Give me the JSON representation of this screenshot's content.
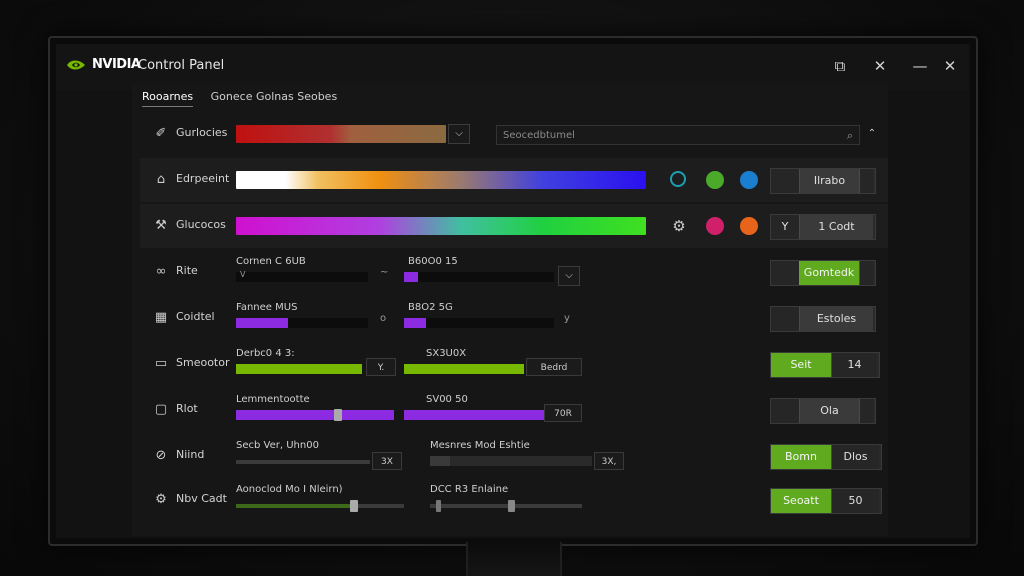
{
  "window": {
    "brand": "NVIDIA",
    "title": "Control Panel"
  },
  "tabs": [
    {
      "label": "Rooarnes",
      "active": true
    },
    {
      "label": "Gonece Golnas Seobes",
      "active": false
    }
  ],
  "colors": {
    "accent_green": "#76b900",
    "button_green": "#5faa1e",
    "purple": "#8c2be2"
  },
  "rows": {
    "r1": {
      "icon": "brush-icon",
      "label": "Gurlocies",
      "search_placeholder": "Seocedbtumel"
    },
    "r2": {
      "icon": "person-icon",
      "label": "Edrpeeint",
      "button": "Ilrabo"
    },
    "r3": {
      "icon": "tools-icon",
      "label": "Glucocos",
      "button_left": "Y",
      "button_right": "1 Codt"
    },
    "r4": {
      "icon": "link-icon",
      "label": "Rite",
      "ctrl1_label": "Cornen C 6UB",
      "ctrl1_sub": "V",
      "ctrl1_mark": "~",
      "ctrl2_label": "B60O0 15",
      "button": "Gomtedk"
    },
    "r5": {
      "icon": "grid-icon",
      "label": "Coidtel",
      "ctrl1_label": "Fannee MUS",
      "ctrl1_mark": "o",
      "ctrl2_label": "B8O2 5G",
      "ctrl2_mark": "y",
      "button": "Estoles"
    },
    "r6": {
      "icon": "monitor-icon",
      "label": "Smeootor",
      "ctrl1_label": "Derbc0 4 3:",
      "ctrl1_box": "Y.",
      "ctrl2_label": "SX3U0X",
      "ctrl2_box": "Bedrd",
      "button_left": "Seit",
      "button_right": "14"
    },
    "r7": {
      "icon": "chat-icon",
      "label": "Rlot",
      "ctrl1_label": "Lemmentootte",
      "ctrl2_label": "SV00 50",
      "ctrl2_box": "70R",
      "button": "Ola"
    },
    "r8": {
      "icon": "tag-icon",
      "label": "Niind",
      "ctrl1_label": "Secb Ver, Uhn00",
      "ctrl1_box": "3X",
      "ctrl2_label": "Mesnres Mod Eshtie",
      "ctrl2_box": "3X,",
      "button_left": "Bomn",
      "button_right": "Dlos"
    },
    "r9": {
      "icon": "gear-icon",
      "label": "Nbv Cadt",
      "ctrl1_label": "Aonoclod Mo I Nleirn)",
      "ctrl2_label": "DCC R3 Enlaine",
      "button_left": "Seoatt",
      "button_right": "50"
    }
  }
}
